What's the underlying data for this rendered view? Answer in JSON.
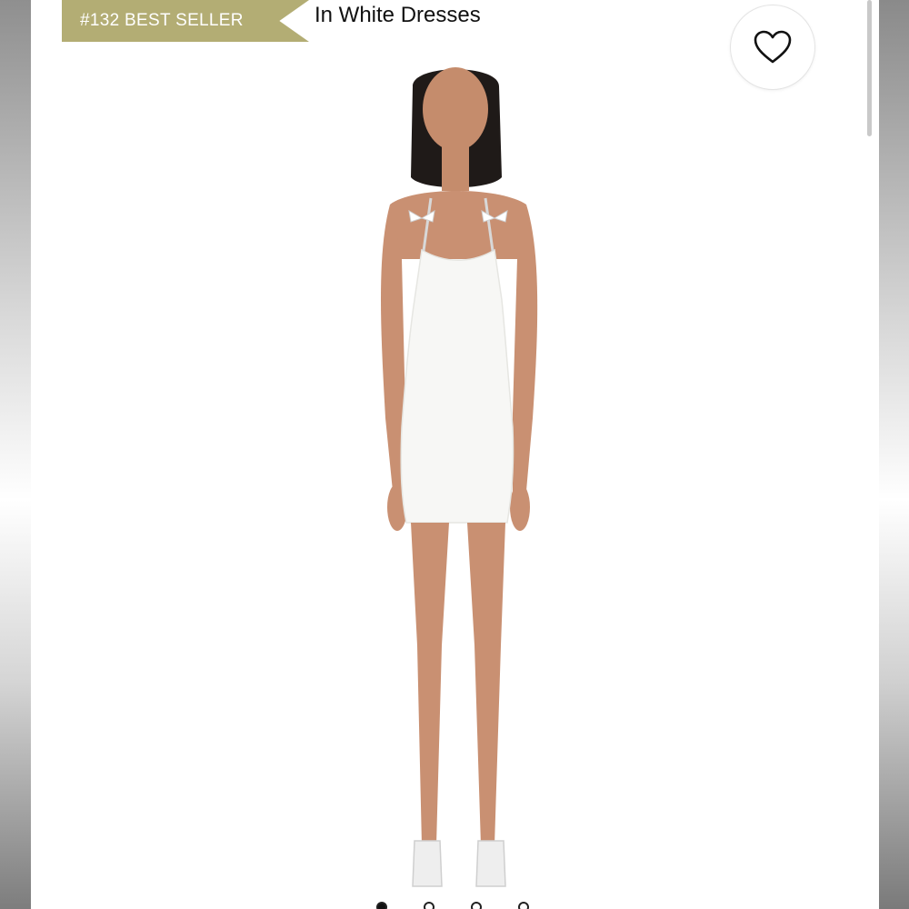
{
  "badge": {
    "text": "#132 BEST SELLER",
    "color": "#b3ad74"
  },
  "category": {
    "text": "In White Dresses"
  },
  "favorite": {
    "icon": "heart-icon"
  },
  "product": {
    "image_icon": "model-white-mini-dress-image"
  },
  "carousel": {
    "dots": 4,
    "active_index": 0
  }
}
